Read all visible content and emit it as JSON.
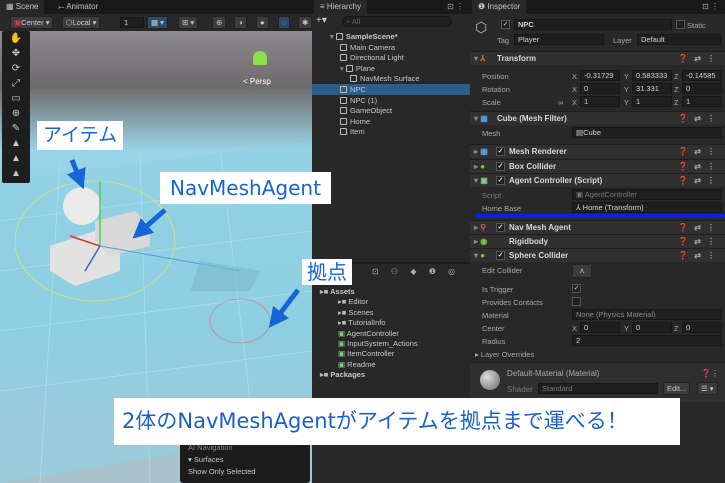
{
  "scene": {
    "tabs": [
      "Scene",
      "Animator"
    ],
    "pivot": "Center",
    "space": "Local",
    "grid_value": "1",
    "persp_label": "< Persp"
  },
  "hierarchy": {
    "title": "Hierarchy",
    "search_placeholder": "All",
    "items": [
      {
        "label": "SampleScene*",
        "level": 0,
        "bold": true
      },
      {
        "label": "Main Camera",
        "level": 1
      },
      {
        "label": "Directional Light",
        "level": 1
      },
      {
        "label": "Plane",
        "level": 1
      },
      {
        "label": "NavMesh Surface",
        "level": 2
      },
      {
        "label": "NPC",
        "level": 1,
        "selected": true
      },
      {
        "label": "NPC (1)",
        "level": 1
      },
      {
        "label": "GameObject",
        "level": 1
      },
      {
        "label": "Home",
        "level": 1
      },
      {
        "label": "Item",
        "level": 1
      }
    ]
  },
  "project": {
    "items": [
      {
        "label": "Assets",
        "level": 0,
        "bold": true
      },
      {
        "label": "Editor",
        "level": 1
      },
      {
        "label": "Scenes",
        "level": 1
      },
      {
        "label": "TutorialInfo",
        "level": 1
      },
      {
        "label": "AgentController",
        "level": 1
      },
      {
        "label": "InputSystem_Actions",
        "level": 1
      },
      {
        "label": "ItemController",
        "level": 1
      },
      {
        "label": "Readme",
        "level": 1
      },
      {
        "label": "Packages",
        "level": 0,
        "bold": true
      }
    ]
  },
  "overlay": {
    "title": "AI Navigation",
    "section": "Surfaces",
    "option": "Show Only Selected"
  },
  "inspector": {
    "title": "Inspector",
    "object_name": "NPC",
    "static_label": "Static",
    "tag_label": "Tag",
    "tag": "Player",
    "layer_label": "Layer",
    "layer": "Default",
    "transform": {
      "title": "Transform",
      "rows": [
        {
          "label": "Position",
          "x": "-0.31729",
          "y": "0.583333",
          "z": "-0.14585"
        },
        {
          "label": "Rotation",
          "x": "0",
          "y": "31.331",
          "z": "0"
        },
        {
          "label": "Scale",
          "x": "1",
          "y": "1",
          "z": "1"
        }
      ]
    },
    "mesh_filter": {
      "title": "Cube (Mesh Filter)",
      "mesh_label": "Mesh",
      "mesh": "Cube"
    },
    "mesh_renderer": "Mesh Renderer",
    "box_collider": "Box Collider",
    "agent_controller": {
      "title": "Agent Controller (Script)",
      "script_label": "Script",
      "script": "AgentController",
      "home_label": "Home Base",
      "home": "Home (Transform)"
    },
    "nav_mesh_agent": "Nav Mesh Agent",
    "rigidbody": "Rigidbody",
    "sphere_collider": {
      "title": "Sphere Collider",
      "edit_label": "Edit Collider",
      "trigger_label": "Is Trigger",
      "contacts_label": "Provides Contacts",
      "material_label": "Material",
      "material": "None (Physics Material)",
      "center_label": "Center",
      "cx": "0",
      "cy": "0",
      "cz": "0",
      "radius_label": "Radius",
      "radius": "2",
      "overrides": "Layer Overrides"
    },
    "material": {
      "title": "Default-Material (Material)",
      "shader_label": "Shader",
      "shader": "Standard",
      "edit": "Edit..."
    }
  },
  "annotations": {
    "item": "アイテム",
    "agent": "NavMeshAgent",
    "base": "拠点",
    "caption": "2体のNavMeshAgentがアイテムを拠点まで運べる！",
    "color": "#1565d8"
  }
}
